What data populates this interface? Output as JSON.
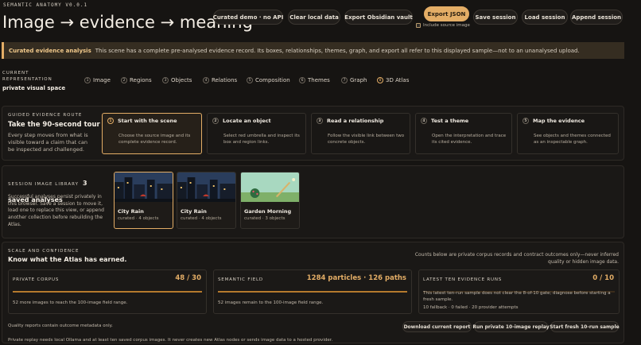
{
  "app": {
    "brand": "SEMANTIC ANATOMY V0.0.1",
    "title": "Image → evidence → meaning"
  },
  "toolbar": {
    "curated_demo": "Curated demo · no API",
    "clear_local": "Clear local data",
    "export_obsidian": "Export Obsidian vault",
    "export_json": "Export JSON",
    "include_source": "Include source image",
    "save_session": "Save session",
    "load_session": "Load session",
    "append_session": "Append session"
  },
  "banner": {
    "title": "Curated evidence analysis",
    "text": "This scene has a complete pre-analysed evidence record. Its boxes, relationships, themes, graph, and export all refer to this displayed sample—not to an unanalysed upload."
  },
  "representation": {
    "label": "CURRENT REPRESENTATION",
    "value": "private visual space",
    "steps": [
      {
        "n": "1",
        "label": "Image"
      },
      {
        "n": "2",
        "label": "Regions"
      },
      {
        "n": "3",
        "label": "Objects"
      },
      {
        "n": "4",
        "label": "Relations"
      },
      {
        "n": "5",
        "label": "Composition"
      },
      {
        "n": "6",
        "label": "Themes"
      },
      {
        "n": "7",
        "label": "Graph"
      },
      {
        "n": "8",
        "label": "3D Atlas"
      }
    ]
  },
  "route": {
    "label": "GUIDED EVIDENCE ROUTE",
    "title": "Take the 90-second tour",
    "desc": "Every step moves from what is visible toward a claim that can be inspected and challenged.",
    "cards": [
      {
        "n": "1",
        "title": "Start with the scene",
        "desc": "Choose the source image and its complete evidence record."
      },
      {
        "n": "2",
        "title": "Locate an object",
        "desc": "Select red umbrella and inspect its box and region links."
      },
      {
        "n": "3",
        "title": "Read a relationship",
        "desc": "Follow the visible link between two concrete objects."
      },
      {
        "n": "4",
        "title": "Test a theme",
        "desc": "Open the interpretation and trace its cited evidence."
      },
      {
        "n": "5",
        "title": "Map the evidence",
        "desc": "See objects and themes connected as an inspectable graph."
      }
    ]
  },
  "library": {
    "label": "SESSION IMAGE LIBRARY",
    "count": "3 saved analyses",
    "desc": "Successful analyses persist privately in this browser. Save a session to move it, load one to replace this view, or append another collection before rebuilding the Atlas.",
    "items": [
      {
        "title": "City Rain",
        "sub": "curated · 4 objects"
      },
      {
        "title": "City Rain",
        "sub": "curated · 4 objects"
      },
      {
        "title": "Garden Morning",
        "sub": "curated · 3 objects"
      }
    ]
  },
  "scale": {
    "label": "SCALE AND CONFIDENCE",
    "title": "Know what the Atlas has earned.",
    "note": "Counts below are private corpus records and contract outcomes only—never inferred quality or hidden image data.",
    "metrics": [
      {
        "label": "PRIVATE CORPUS",
        "value": "48 / 30",
        "fill": 1.0,
        "note": "52 more images to reach the 100-image field range."
      },
      {
        "label": "SEMANTIC FIELD",
        "value": "1284 particles · 126 paths",
        "fill": 1.0,
        "note": "52 images remain to the 100-image field range."
      },
      {
        "label": "LATEST TEN EVIDENCE RUNS",
        "value": "0 / 10",
        "fill": 0,
        "note": "This latest ten-run sample does not clear the 8-of-10 gate; diagnose before starting a fresh sample.",
        "note2": "10 fallback · 0 failed · 20 provider attempts"
      }
    ],
    "quality_note": "Quality reports contain outcome metadata only.",
    "replay_note": "Private replay needs local Ollama and at least ten saved corpus images. It never creates new Atlas nodes or sends image data to a hosted provider.",
    "buttons": {
      "download": "Download current report",
      "replay": "Run private 10-image replay",
      "fresh": "Start fresh 10-run sample"
    }
  },
  "colors": {
    "accent": "#e3ad66",
    "background": "#161412"
  }
}
